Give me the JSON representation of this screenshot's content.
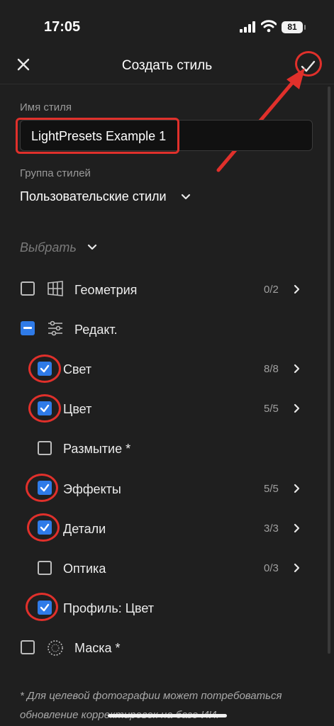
{
  "status_bar": {
    "time": "17:05",
    "battery": "81"
  },
  "nav": {
    "title": "Создать стиль"
  },
  "style_name": {
    "label": "Имя стиля",
    "value": "LightPresets Example 1"
  },
  "style_group": {
    "label": "Группа стилей",
    "value": "Пользовательские стили"
  },
  "choose": {
    "label": "Выбрать"
  },
  "items": [
    {
      "label": "Геометрия",
      "count": "0/2",
      "state": "unchecked",
      "icon": "grid-perspective-icon"
    },
    {
      "label": "Редакт.",
      "count": "",
      "state": "mixed",
      "icon": "sliders-icon"
    },
    {
      "label": "Свет",
      "count": "8/8",
      "state": "checked"
    },
    {
      "label": "Цвет",
      "count": "5/5",
      "state": "checked"
    },
    {
      "label": "Размытие *",
      "count": "",
      "state": "unchecked"
    },
    {
      "label": "Эффекты",
      "count": "5/5",
      "state": "checked"
    },
    {
      "label": "Детали",
      "count": "3/3",
      "state": "checked"
    },
    {
      "label": "Оптика",
      "count": "0/3",
      "state": "unchecked"
    },
    {
      "label": "Профиль: Цвет",
      "count": "",
      "state": "checked"
    },
    {
      "label": "Маска *",
      "count": "",
      "state": "unchecked",
      "icon": "mask-icon"
    }
  ],
  "footnote": "* Для целевой фотографии может потребоваться обновление корректировок на базе ИИ.",
  "colors": {
    "accent": "#2f7be8",
    "annotation": "#e0302b",
    "background": "#1f1f1f"
  }
}
